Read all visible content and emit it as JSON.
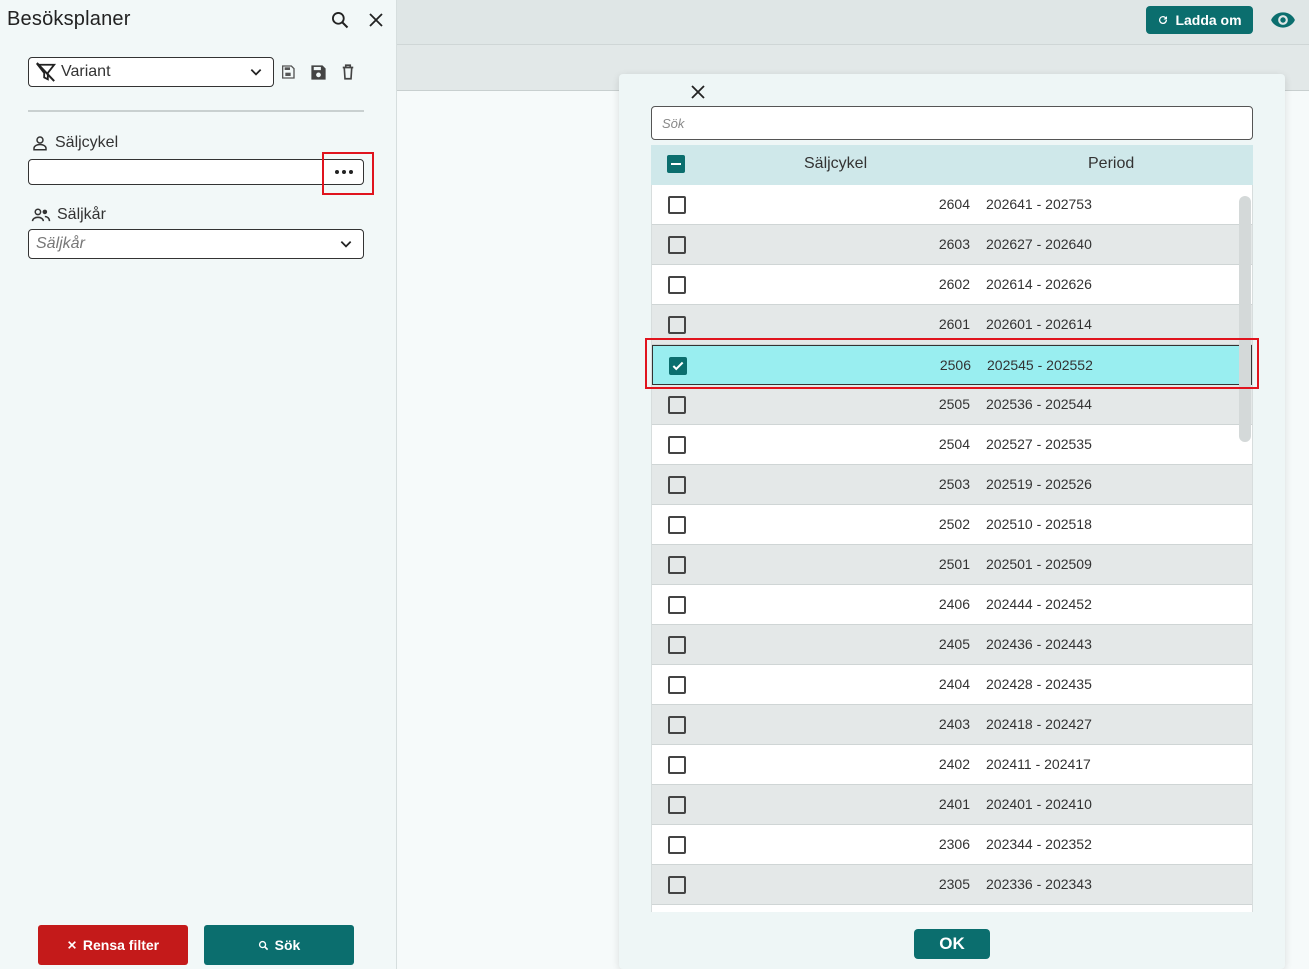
{
  "left_panel": {
    "title": "Besöksplaner",
    "variant_label": "Variant",
    "cycle_label": "Säljcykel",
    "corps_label": "Säljkår",
    "corps_placeholder": "Säljkår",
    "clear_label": "Rensa filter",
    "search_label": "Sök"
  },
  "topbar": {
    "reload_label": "Ladda om"
  },
  "dialog": {
    "search_placeholder": "Sök",
    "columns": {
      "cycle": "Säljcykel",
      "period": "Period"
    },
    "ok_label": "OK",
    "rows": [
      {
        "cycle": "2604",
        "period": "202641 - 202753",
        "checked": false
      },
      {
        "cycle": "2603",
        "period": "202627 - 202640",
        "checked": false
      },
      {
        "cycle": "2602",
        "period": "202614 - 202626",
        "checked": false
      },
      {
        "cycle": "2601",
        "period": "202601 - 202614",
        "checked": false
      },
      {
        "cycle": "2506",
        "period": "202545 - 202552",
        "checked": true
      },
      {
        "cycle": "2505",
        "period": "202536 - 202544",
        "checked": false
      },
      {
        "cycle": "2504",
        "period": "202527 - 202535",
        "checked": false
      },
      {
        "cycle": "2503",
        "period": "202519 - 202526",
        "checked": false
      },
      {
        "cycle": "2502",
        "period": "202510 - 202518",
        "checked": false
      },
      {
        "cycle": "2501",
        "period": "202501 - 202509",
        "checked": false
      },
      {
        "cycle": "2406",
        "period": "202444 - 202452",
        "checked": false
      },
      {
        "cycle": "2405",
        "period": "202436 - 202443",
        "checked": false
      },
      {
        "cycle": "2404",
        "period": "202428 - 202435",
        "checked": false
      },
      {
        "cycle": "2403",
        "period": "202418 - 202427",
        "checked": false
      },
      {
        "cycle": "2402",
        "period": "202411 - 202417",
        "checked": false
      },
      {
        "cycle": "2401",
        "period": "202401 - 202410",
        "checked": false
      },
      {
        "cycle": "2306",
        "period": "202344 - 202352",
        "checked": false
      },
      {
        "cycle": "2305",
        "period": "202336 - 202343",
        "checked": false
      },
      {
        "cycle": "",
        "period": "",
        "checked": false
      }
    ]
  },
  "colors": {
    "primary": "#0b6e6e",
    "danger": "#c41a1a",
    "selected_row": "#99eef0",
    "highlight": "#e0141e"
  }
}
